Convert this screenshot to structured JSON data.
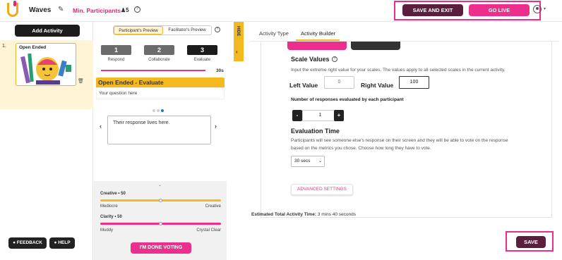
{
  "header": {
    "app_title": "Waves",
    "min_participants": "Min. Participants",
    "participant_count": "5",
    "save_exit": "SAVE AND EXIT",
    "go_live": "GO LIVE"
  },
  "sidebar": {
    "add_activity": "Add Activity",
    "slides": [
      {
        "number": "1.",
        "title": "Open Ended"
      }
    ],
    "feedback": "FEEDBACK",
    "help": "HELP"
  },
  "preview": {
    "tabs": [
      "Participant's Preview",
      "Facilitator's Preview"
    ],
    "active_tab": "Participant's Preview",
    "steps": [
      {
        "num": "1",
        "label": "Respond"
      },
      {
        "num": "2",
        "label": "Collaborate"
      },
      {
        "num": "3",
        "label": "Evaluate"
      }
    ],
    "timer": "30s",
    "title": "Open Ended - Evaluate",
    "question": "Your question here",
    "response": "Their response lives here.",
    "sliders": [
      {
        "name": "Creative",
        "value": "50",
        "value_num": 50,
        "min_label": "Mediocre",
        "max_label": "Creative",
        "color": "#f5b920"
      },
      {
        "name": "Clarity",
        "value": "50",
        "value_num": 50,
        "min_label": "Muddy",
        "max_label": "Crystal Clear",
        "color": "#ec2f8c"
      }
    ],
    "done_button": "I'M DONE VOTING"
  },
  "hide_tab": "HIDE",
  "builder": {
    "tabs": [
      "Activity Type",
      "Activity Builder"
    ],
    "active_tab": "Activity Builder",
    "scale_values_heading": "Scale Values",
    "scale_values_desc": "Input the extreme right value for your scales. The values apply to all selected scales in the current activity.",
    "left_value_label": "Left Value",
    "left_value_placeholder": "0",
    "right_value_label": "Right Value",
    "right_value": "100",
    "responses_heading": "Number of responses evaluated by each participant",
    "responses_minus": "-",
    "responses_value": "1",
    "responses_plus": "+",
    "eval_time_heading": "Evaluation Time",
    "eval_time_desc_1": "Participants will see someone else's response on their screen and they will be able to vote on the response",
    "eval_time_desc_2": "based on the metrics you chose. Choose how long they have to vote.",
    "eval_time_value": "30 secs",
    "advanced_settings": "ADVANCED SETTINGS",
    "estimated_label": "Estimated Total Activity Time:",
    "estimated_value": "3 mins 40 seconds",
    "save": "SAVE"
  },
  "colors": {
    "accent_pink": "#ec2f8c",
    "accent_yellow": "#f5b920",
    "dark_maroon": "#5a1f3c",
    "highlight": "#ea2f8a"
  }
}
